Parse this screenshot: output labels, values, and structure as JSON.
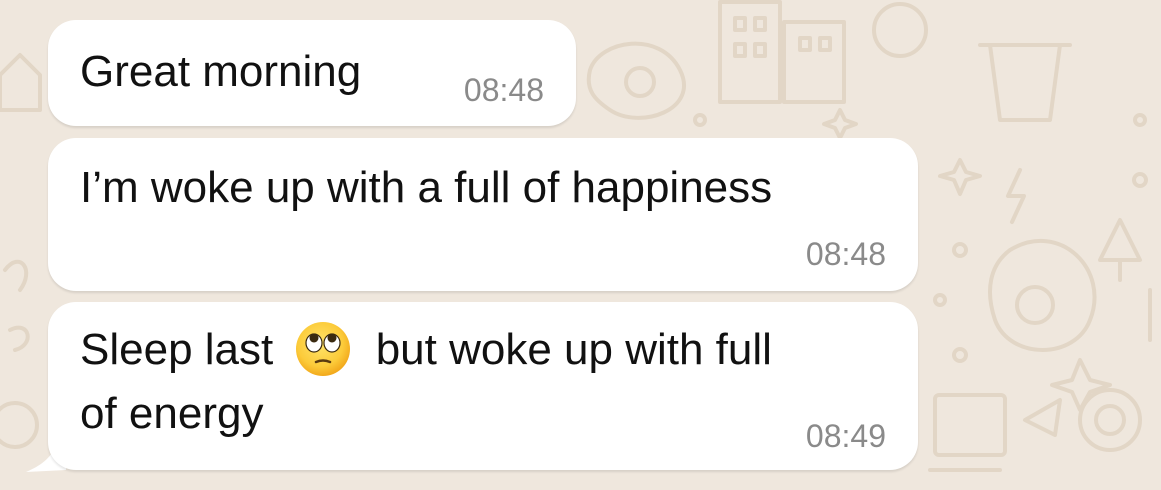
{
  "chat": {
    "background_color": "#efe7dd",
    "bubble_color": "#ffffff",
    "messages": [
      {
        "text": "Great morning",
        "time": "08:48"
      },
      {
        "text": "I’m woke up with a full of happiness",
        "time": "08:48"
      },
      {
        "text_before_emoji": "Sleep last",
        "emoji": "rolling-eyes-emoji",
        "text_after_emoji": "but woke up with full",
        "text_line2": "of energy",
        "time": "08:49"
      }
    ]
  }
}
